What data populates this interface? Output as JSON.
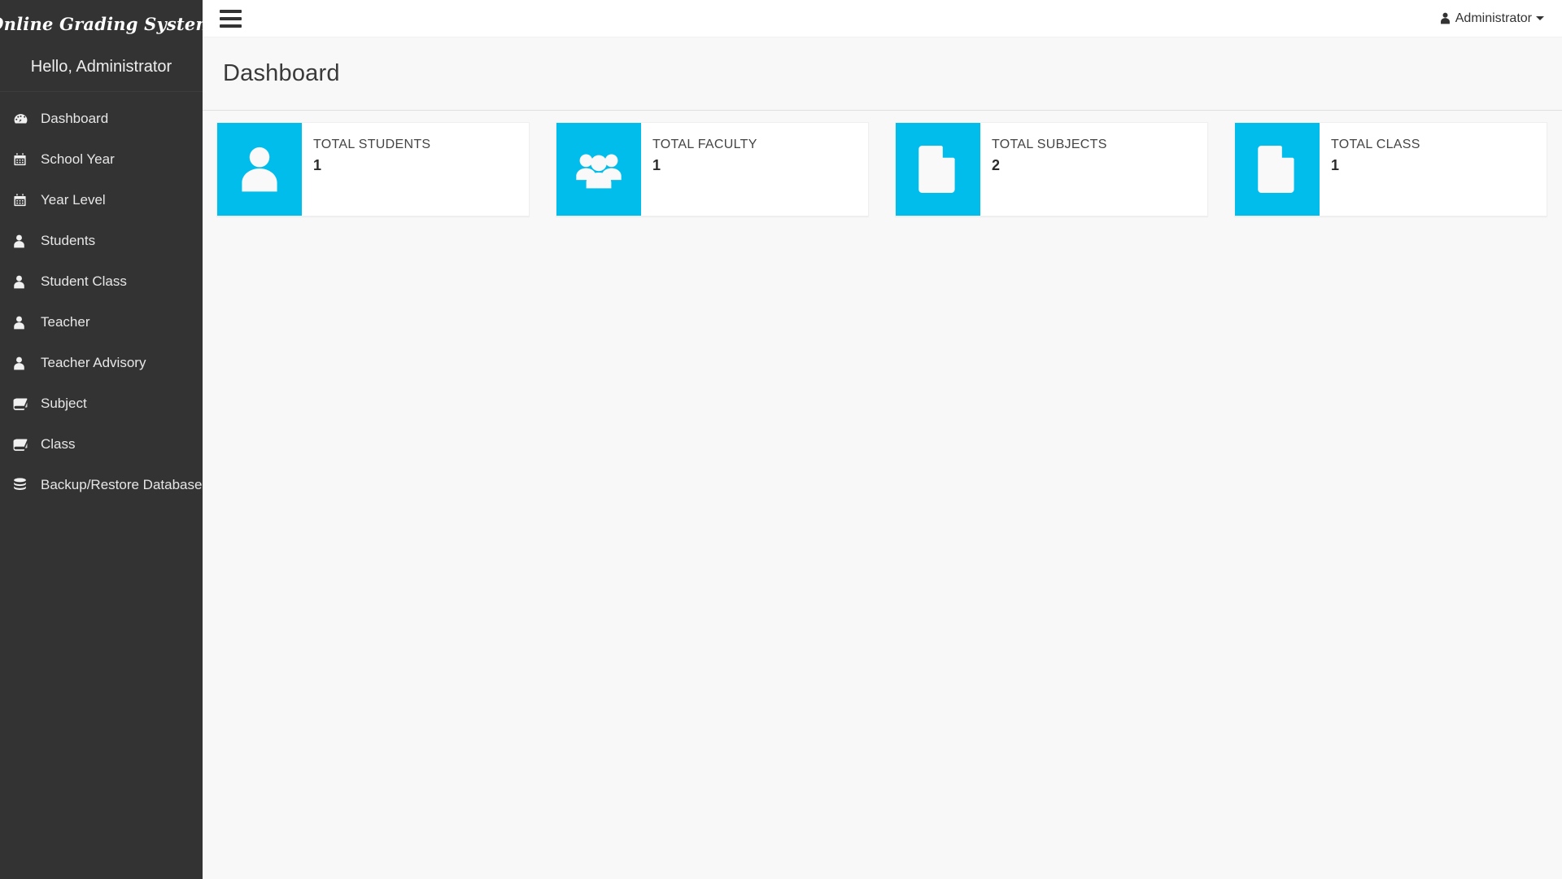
{
  "brand": {
    "title": "Online Grading System",
    "greeting": "Hello, Administrator"
  },
  "navbar": {
    "menu_toggle_label": "Toggle navigation",
    "user_name": "Administrator",
    "user_icon": "user-icon",
    "caret_icon": "caret-down-icon",
    "hamburger_icon": "hamburger-menu-icon"
  },
  "page": {
    "title": "Dashboard"
  },
  "sidebar": {
    "items": [
      {
        "label": "Dashboard",
        "icon": "dashboard-icon"
      },
      {
        "label": "School Year",
        "icon": "calendar-icon"
      },
      {
        "label": "Year Level",
        "icon": "calendar-icon"
      },
      {
        "label": "Students",
        "icon": "user-icon"
      },
      {
        "label": "Student Class",
        "icon": "user-icon"
      },
      {
        "label": "Teacher",
        "icon": "user-icon"
      },
      {
        "label": "Teacher Advisory",
        "icon": "user-icon"
      },
      {
        "label": "Subject",
        "icon": "book-icon"
      },
      {
        "label": "Class",
        "icon": "book-icon"
      },
      {
        "label": "Backup/Restore Database",
        "icon": "database-icon"
      }
    ]
  },
  "cards": [
    {
      "label": "TOTAL STUDENTS",
      "value": "1",
      "icon": "user-icon"
    },
    {
      "label": "TOTAL FACULTY",
      "value": "1",
      "icon": "users-group-icon"
    },
    {
      "label": "TOTAL SUBJECTS",
      "value": "2",
      "icon": "file-icon"
    },
    {
      "label": "TOTAL CLASS",
      "value": "1",
      "icon": "file-icon"
    }
  ],
  "colors": {
    "sidebar_bg": "#333333",
    "accent": "#00bdec",
    "page_bg": "#f8f8f8",
    "card_bg": "#ffffff",
    "text_dark": "#333333"
  }
}
